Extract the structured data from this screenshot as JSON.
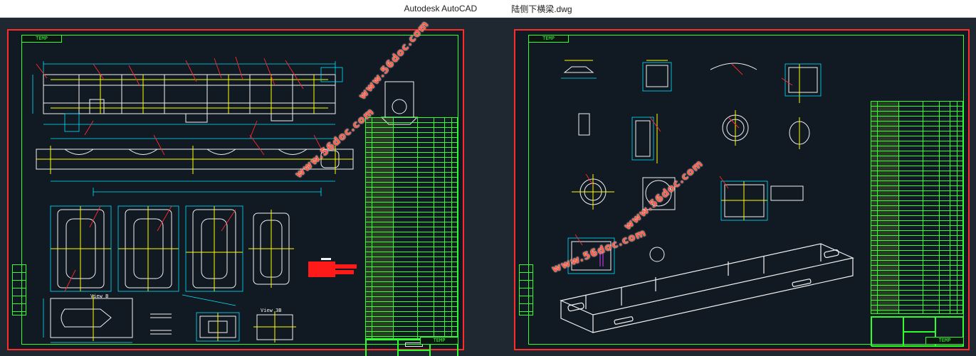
{
  "window": {
    "app_title": "Autodesk AutoCAD",
    "file_name": "陆侧下横梁.dwg"
  },
  "sheets": {
    "left": {
      "frame_label": "TEMP",
      "titleblock_label": "TEMP",
      "view_label_a": "View B",
      "view_label_b": "View 3B"
    },
    "right": {
      "frame_label": "TEMP",
      "titleblock_label": "TEMP"
    }
  },
  "watermarks": [
    {
      "text": "www.56doc.com"
    },
    {
      "text": "www.56doc.com"
    },
    {
      "text": "www.56doc.com"
    },
    {
      "text": "www.56doc.com"
    }
  ],
  "colors": {
    "background": "#1f2730",
    "frame": "#2dff2d",
    "border": "#ff2a2a",
    "dimension": "#00e5ff",
    "annotation": "#ffff00",
    "geometry": "#f2f2f2"
  }
}
